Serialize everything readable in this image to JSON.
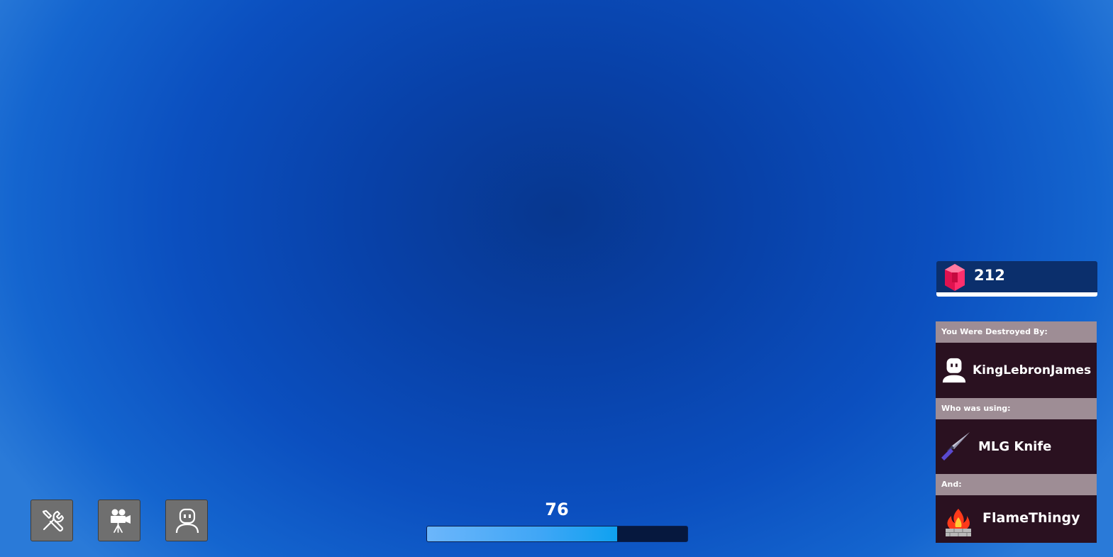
{
  "currency": {
    "icon": "gem-icon",
    "amount": "212",
    "color": "#ff2f6d"
  },
  "killfeed": {
    "destroyed_by_label": "You Were Destroyed By:",
    "killer_name": "KingLebronJames",
    "killer_icon": "avatar-icon",
    "weapon_label": "Who was using:",
    "weapon_name": "MLG Knife",
    "weapon_icon": "knife-icon",
    "extra_label": "And:",
    "extra_name": "FlameThingy",
    "extra_icon": "flame-wall-icon"
  },
  "toolbar": {
    "buttons": [
      {
        "icon": "tools-icon"
      },
      {
        "icon": "camera-icon"
      },
      {
        "icon": "character-icon"
      }
    ]
  },
  "health": {
    "value": "76",
    "fraction": 0.73,
    "fill_color": "#3fa6f6"
  },
  "colors": {
    "background": "#0841a8",
    "panel_dark": "#2a1120",
    "panel_header": "#9e8d95",
    "gem_panel": "#0b2f6c"
  }
}
